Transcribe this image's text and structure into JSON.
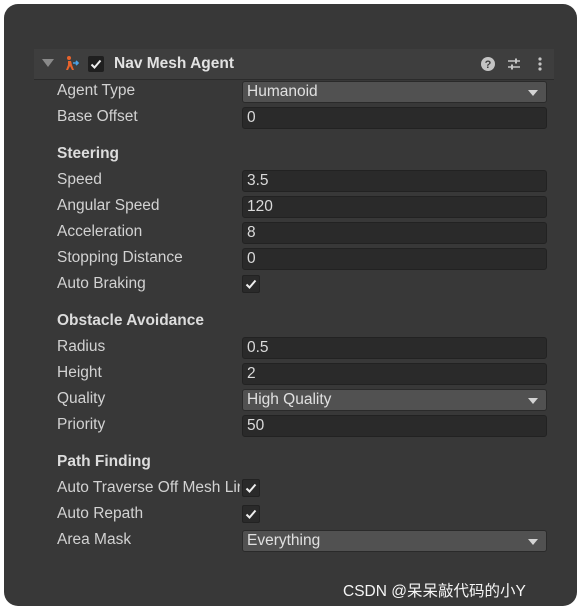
{
  "component": {
    "title": "Nav Mesh Agent",
    "enabled": true,
    "icons": [
      "foldout-arrow-icon",
      "nav-mesh-agent-icon",
      "help-icon",
      "presets-icon",
      "more-options-icon"
    ]
  },
  "fields": {
    "agent_type": {
      "label": "Agent Type",
      "value": "Humanoid"
    },
    "base_offset": {
      "label": "Base Offset",
      "value": "0"
    }
  },
  "steering": {
    "heading": "Steering",
    "speed": {
      "label": "Speed",
      "value": "3.5"
    },
    "angular_speed": {
      "label": "Angular Speed",
      "value": "120"
    },
    "acceleration": {
      "label": "Acceleration",
      "value": "8"
    },
    "stopping_distance": {
      "label": "Stopping Distance",
      "value": "0"
    },
    "auto_braking": {
      "label": "Auto Braking",
      "checked": true
    }
  },
  "obstacle_avoidance": {
    "heading": "Obstacle Avoidance",
    "radius": {
      "label": "Radius",
      "value": "0.5"
    },
    "height": {
      "label": "Height",
      "value": "2"
    },
    "quality": {
      "label": "Quality",
      "value": "High Quality"
    },
    "priority": {
      "label": "Priority",
      "value": "50"
    }
  },
  "path_finding": {
    "heading": "Path Finding",
    "auto_traverse": {
      "label": "Auto Traverse Off Mesh Link",
      "checked": true
    },
    "auto_repath": {
      "label": "Auto Repath",
      "checked": true
    },
    "area_mask": {
      "label": "Area Mask",
      "value": "Everything"
    }
  },
  "watermark": "CSDN @呆呆敲代码的小Y",
  "colors": {
    "panel_bg": "#383838",
    "field_bg": "#2a2a2a",
    "dropdown_bg": "#515151",
    "text": "#d2d2d2",
    "icon_accent": "#e8632b"
  }
}
